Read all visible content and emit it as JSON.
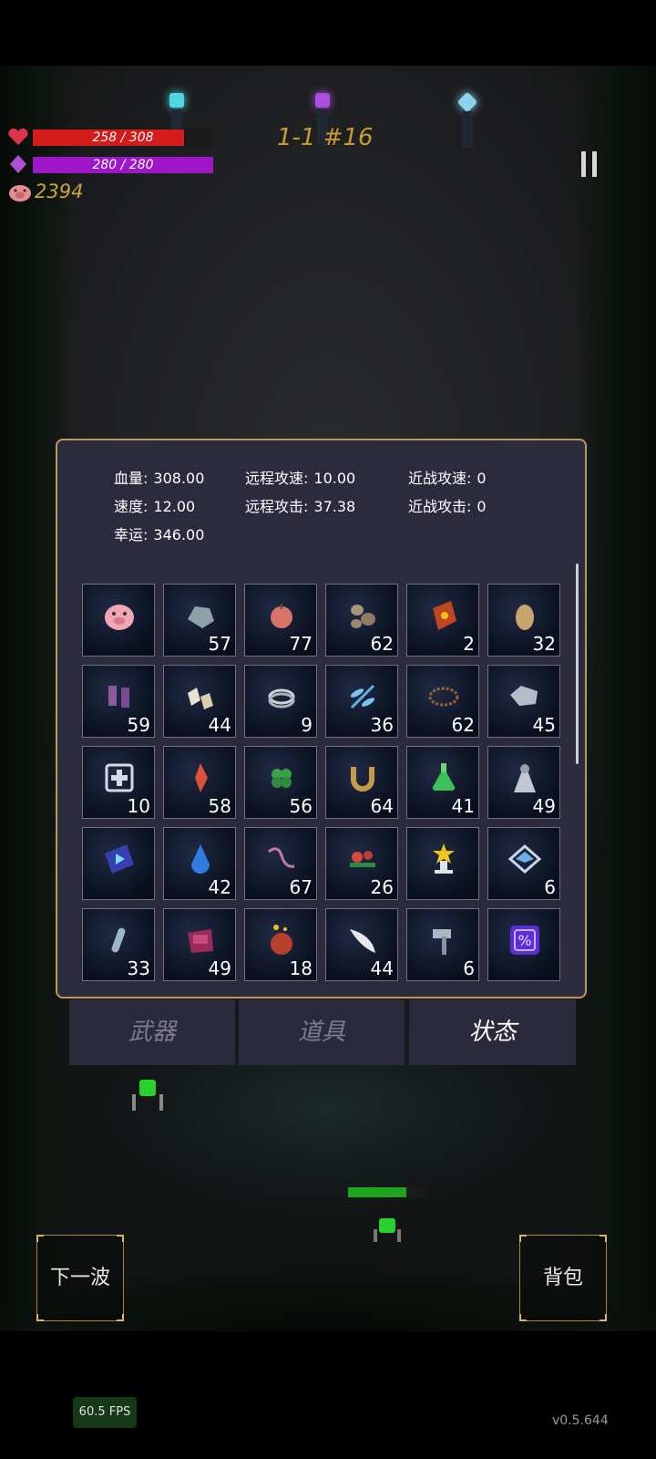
{
  "hud": {
    "hp_text": "258 / 308",
    "hp_fraction": 0.838,
    "mana_text": "280 / 280",
    "mana_fraction": 1.0,
    "coins": "2394",
    "wave": "1-1 #16",
    "colors": {
      "hp": "#d31b1b",
      "mana": "#9d17c9",
      "gold": "#c79a2f"
    }
  },
  "stats": {
    "hp_label": "血量:",
    "hp_value": "308.00",
    "ranged_speed_label": "远程攻速:",
    "ranged_speed_value": "10.00",
    "melee_speed_label": "近战攻速:",
    "melee_speed_value": "0",
    "speed_label": "速度:",
    "speed_value": "12.00",
    "ranged_attack_label": "远程攻击:",
    "ranged_attack_value": "37.38",
    "melee_attack_label": "近战攻击:",
    "melee_attack_value": "0",
    "luck_label": "幸运:",
    "luck_value": "346.00"
  },
  "items": [
    {
      "icon": "piggy-bank-icon",
      "count": ""
    },
    {
      "icon": "gray-rock-icon",
      "count": "57"
    },
    {
      "icon": "red-apple-icon",
      "count": "77"
    },
    {
      "icon": "pebbles-icon",
      "count": "62"
    },
    {
      "icon": "red-book-icon",
      "count": "2"
    },
    {
      "icon": "egg-icon",
      "count": "32"
    },
    {
      "icon": "purple-boots-icon",
      "count": "59"
    },
    {
      "icon": "crystals-icon",
      "count": "44"
    },
    {
      "icon": "ring-icon",
      "count": "9"
    },
    {
      "icon": "blue-dragonfly-icon",
      "count": "36"
    },
    {
      "icon": "thorn-crown-icon",
      "count": "62"
    },
    {
      "icon": "silver-ore-icon",
      "count": "45"
    },
    {
      "icon": "medkit-icon",
      "count": "10"
    },
    {
      "icon": "red-crystal-icon",
      "count": "58"
    },
    {
      "icon": "clover-icon",
      "count": "56"
    },
    {
      "icon": "horseshoe-icon",
      "count": "64"
    },
    {
      "icon": "green-potion-icon",
      "count": "41"
    },
    {
      "icon": "cloak-icon",
      "count": "49"
    },
    {
      "icon": "rune-tome-icon",
      "count": ""
    },
    {
      "icon": "blue-drop-icon",
      "count": "42"
    },
    {
      "icon": "worm-icon",
      "count": "67"
    },
    {
      "icon": "red-flowers-icon",
      "count": "26"
    },
    {
      "icon": "star-trophy-icon",
      "count": ""
    },
    {
      "icon": "diamond-emblem-icon",
      "count": "6"
    },
    {
      "icon": "vial-icon",
      "count": "33"
    },
    {
      "icon": "purple-pouch-icon",
      "count": "49"
    },
    {
      "icon": "treasure-sack-icon",
      "count": "18"
    },
    {
      "icon": "feather-icon",
      "count": "44"
    },
    {
      "icon": "hammer-icon",
      "count": "6"
    },
    {
      "icon": "percent-rune-icon",
      "count": ""
    }
  ],
  "tabs": {
    "weapons": "武器",
    "items": "道具",
    "status": "状态",
    "active": "status"
  },
  "buttons": {
    "next_wave": "下一波",
    "backpack": "背包"
  },
  "footer": {
    "fps": "60.5 FPS",
    "version": "v0.5.644"
  }
}
